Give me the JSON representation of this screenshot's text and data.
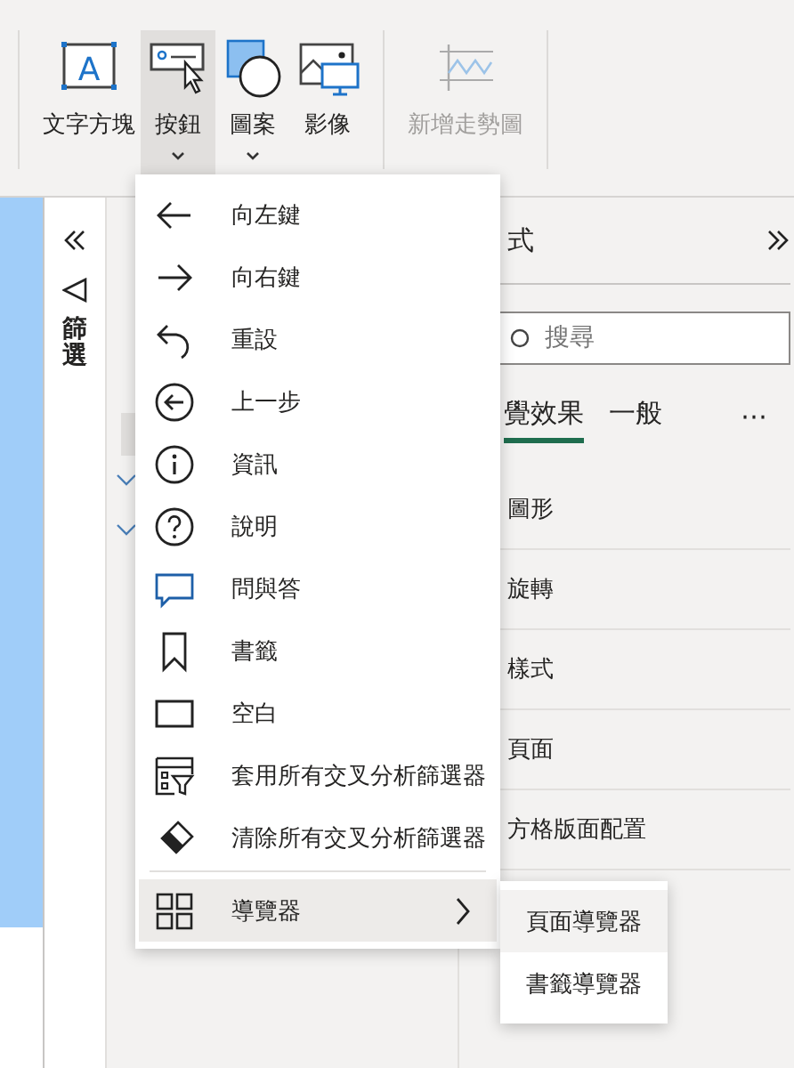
{
  "ribbon": {
    "buttons": [
      {
        "label": "文字方塊",
        "kind": "textbox",
        "icon_text": "A",
        "selected": false,
        "disabled": false,
        "dropdown": false
      },
      {
        "label": "按鈕",
        "kind": "button",
        "selected": true,
        "disabled": false,
        "dropdown": true
      },
      {
        "label": "圖案",
        "kind": "shapes",
        "selected": false,
        "disabled": false,
        "dropdown": true
      },
      {
        "label": "影像",
        "kind": "image",
        "selected": false,
        "disabled": false,
        "dropdown": false
      },
      {
        "label": "新增走勢圖",
        "kind": "sparkline",
        "selected": false,
        "disabled": true,
        "dropdown": false
      }
    ]
  },
  "filters_pane": {
    "label": "篩選"
  },
  "format_pane": {
    "title": "式",
    "search": {
      "placeholder": "搜尋"
    },
    "tabs": [
      {
        "label": "覺效果",
        "selected": true
      },
      {
        "label": "一般",
        "selected": false
      }
    ],
    "more": "⋯",
    "sections": [
      "圖形",
      "旋轉",
      "樣式",
      "頁面",
      "方格版面配置"
    ]
  },
  "menu": {
    "items": [
      {
        "label": "向左鍵",
        "kind": "arrow-left",
        "selected": false,
        "submenu": false
      },
      {
        "label": "向右鍵",
        "kind": "arrow-right",
        "selected": false,
        "submenu": false
      },
      {
        "label": "重設",
        "kind": "reset",
        "selected": false,
        "submenu": false
      },
      {
        "label": "上一步",
        "kind": "back",
        "selected": false,
        "submenu": false
      },
      {
        "label": "資訊",
        "kind": "info",
        "selected": false,
        "submenu": false
      },
      {
        "label": "說明",
        "kind": "help",
        "selected": false,
        "submenu": false
      },
      {
        "label": "問與答",
        "kind": "qna",
        "selected": false,
        "submenu": false
      },
      {
        "label": "書籤",
        "kind": "bookmark",
        "selected": false,
        "submenu": false
      },
      {
        "label": "空白",
        "kind": "blank",
        "selected": false,
        "submenu": false
      },
      {
        "label": "套用所有交叉分析篩選器",
        "kind": "apply",
        "selected": false,
        "submenu": false
      },
      {
        "label": "清除所有交叉分析篩選器",
        "kind": "eraser",
        "selected": false,
        "submenu": false
      },
      {
        "label": "導覽器",
        "kind": "grid",
        "selected": true,
        "submenu": true
      }
    ],
    "submenu": {
      "items": [
        {
          "label": "頁面導覽器",
          "selected": true
        },
        {
          "label": "書籤導覽器",
          "selected": false
        }
      ]
    }
  }
}
